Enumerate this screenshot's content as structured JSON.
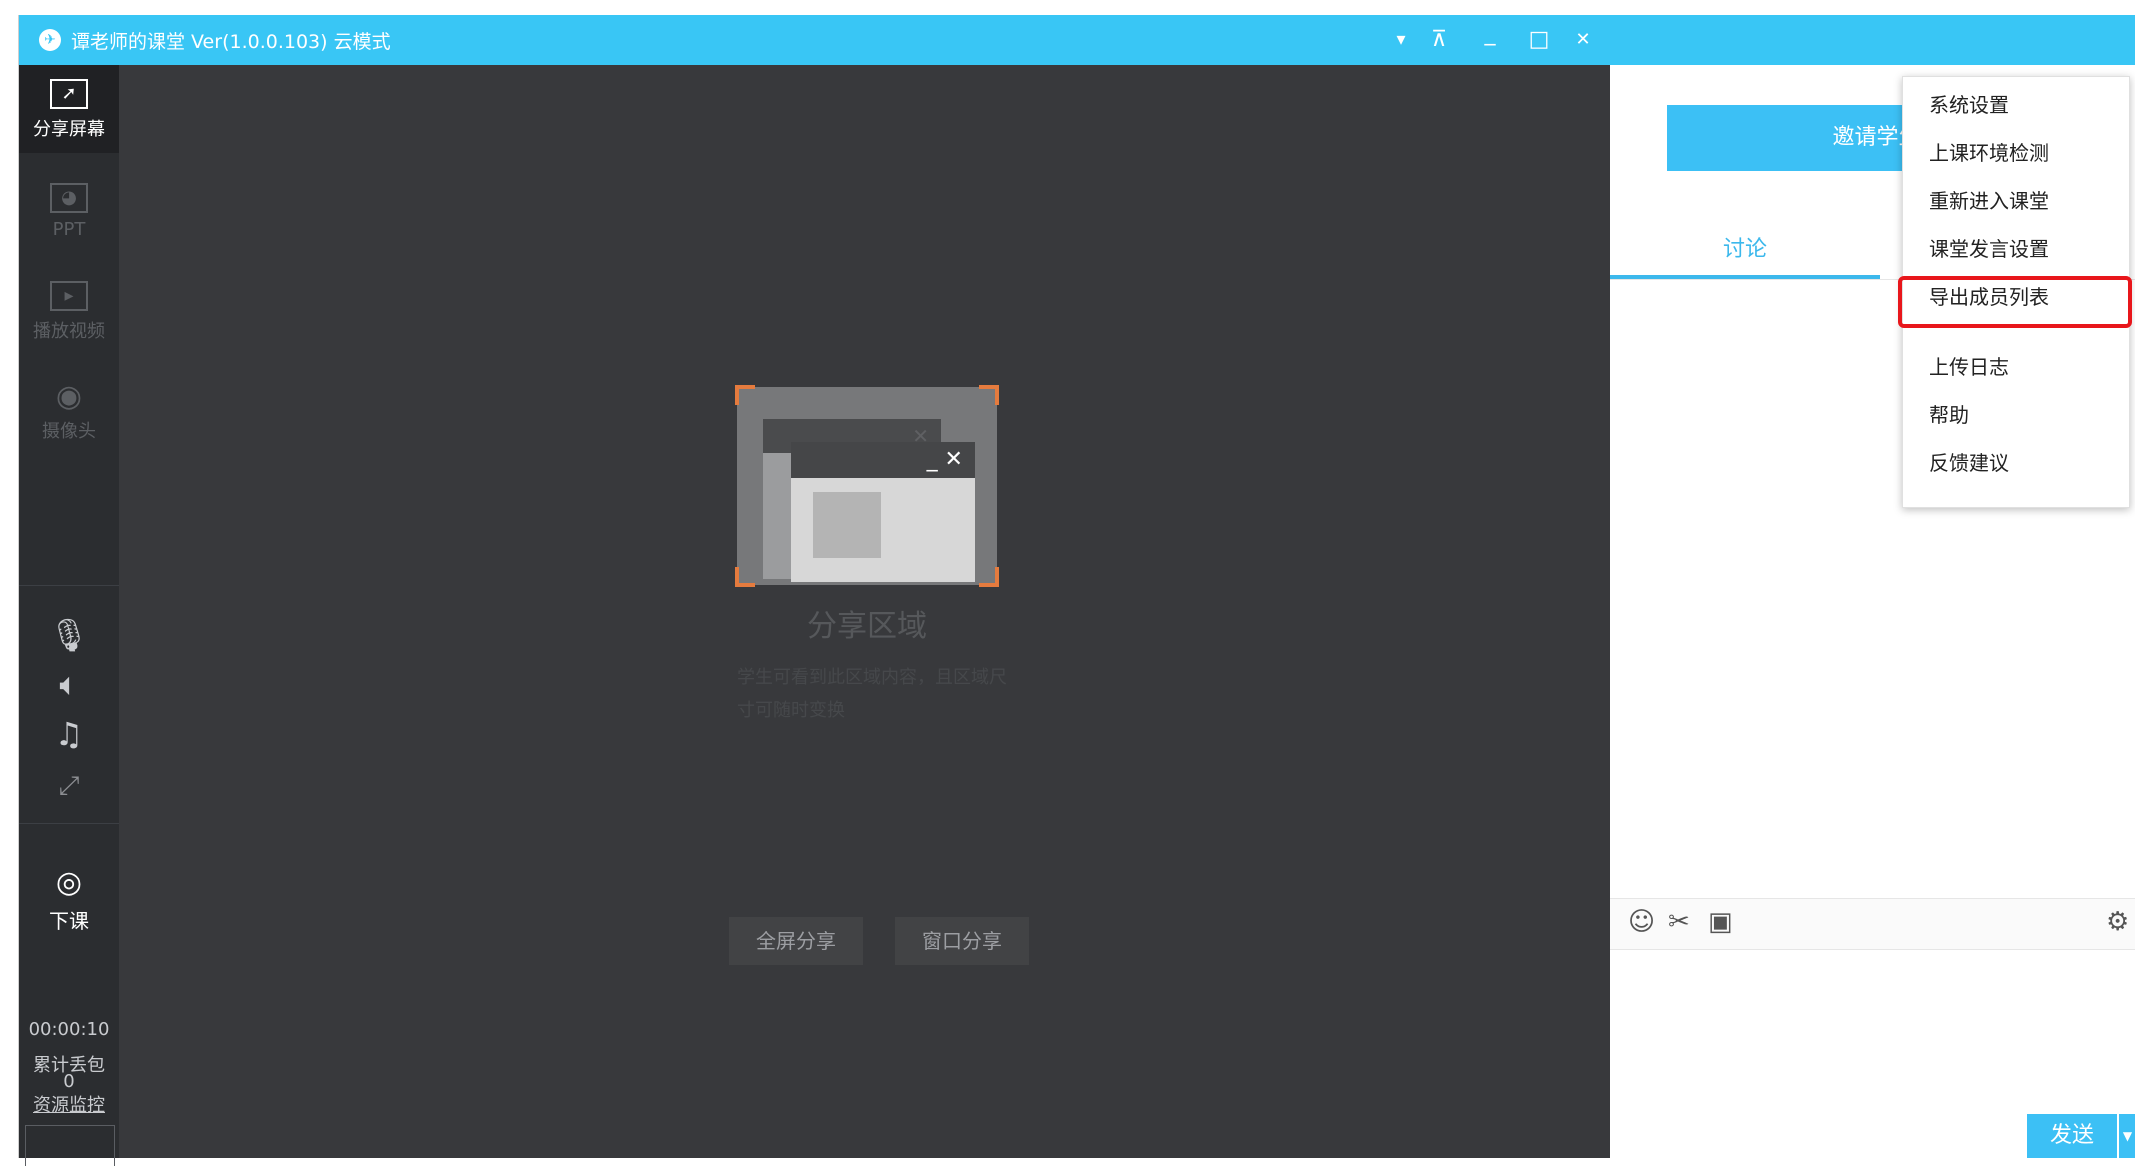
{
  "window": {
    "title": "谭老师的课堂 Ver(1.0.0.103) 云模式",
    "logo_icon": "classroom-logo-icon",
    "controls": {
      "dropdown": "▾",
      "pin": "⊼",
      "minimize": "_",
      "maximize": "□",
      "close": "✕"
    }
  },
  "sidebar": {
    "items": [
      {
        "label": "分享屏幕",
        "icon": "share-screen-icon",
        "active": true
      },
      {
        "label": "PPT",
        "icon": "ppt-icon",
        "active": false
      },
      {
        "label": "播放视频",
        "icon": "play-video-icon",
        "active": false
      },
      {
        "label": "摄像头",
        "icon": "camera-icon",
        "active": false
      }
    ],
    "end_class": "下课",
    "timer": "00:00:10",
    "packet_loss_label": "累计丢包",
    "packet_loss_value": "0",
    "resource_monitor": "资源监控"
  },
  "stage": {
    "title": "分享区域",
    "description": "学生可看到此区域内容，且区域尺寸可随时变换",
    "fullscreen_share": "全屏分享",
    "window_share": "窗口分享"
  },
  "right_panel": {
    "invite_button": "邀请学生",
    "tab_discussion": "讨论",
    "send": "发送"
  },
  "menu": {
    "items": [
      "系统设置",
      "上课环境检测",
      "重新进入课堂",
      "课堂发言设置",
      "导出成员列表",
      "上传日志",
      "帮助",
      "反馈建议"
    ],
    "highlighted": "导出成员列表",
    "highlight_color": "#e8161b"
  },
  "colors": {
    "accent": "#39c6f5",
    "stage_bg": "#38393c",
    "sidebar_bg": "#2b2d30",
    "illustration_corner": "#e57b3e"
  }
}
